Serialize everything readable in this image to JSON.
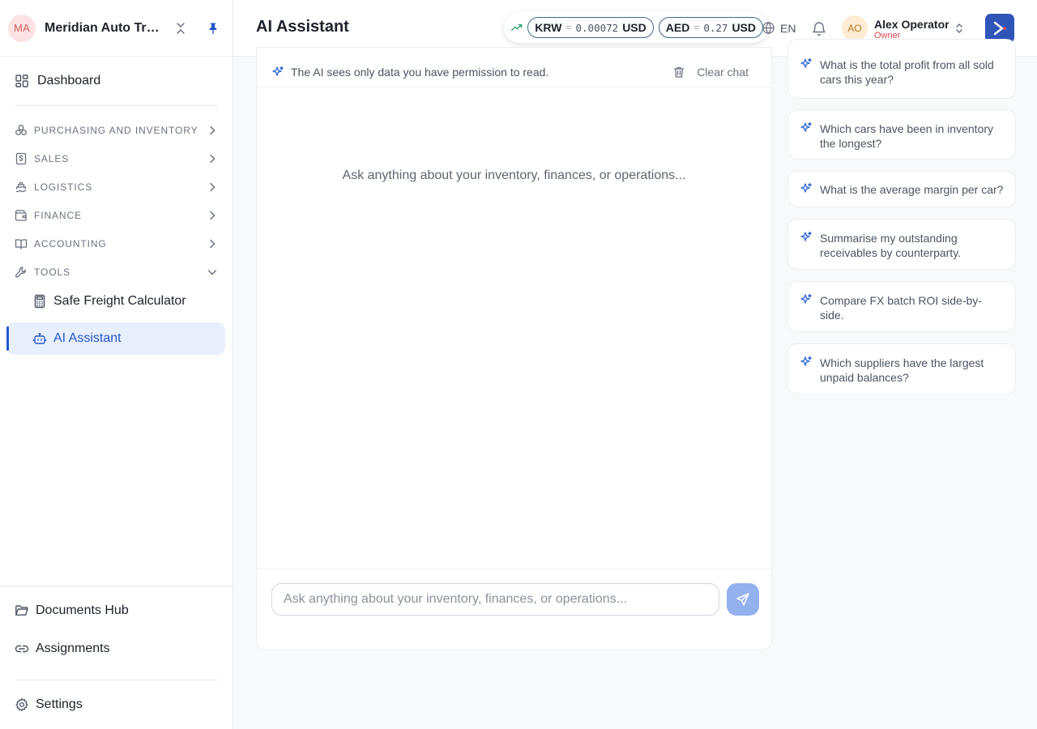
{
  "org": {
    "initials": "MA",
    "name": "Meridian Auto Trading"
  },
  "sidebar": {
    "dashboard": "Dashboard",
    "sections": [
      {
        "label": "PURCHASING AND INVENTORY",
        "icon": "cube-cluster-icon",
        "expanded": false
      },
      {
        "label": "SALES",
        "icon": "dollar-receipt-icon",
        "expanded": false
      },
      {
        "label": "LOGISTICS",
        "icon": "ship-icon",
        "expanded": false
      },
      {
        "label": "FINANCE",
        "icon": "wallet-icon",
        "expanded": false
      },
      {
        "label": "ACCOUNTING",
        "icon": "book-open-icon",
        "expanded": false
      },
      {
        "label": "TOOLS",
        "icon": "wrench-icon",
        "expanded": true
      }
    ],
    "tools_items": [
      {
        "label": "Safe Freight Calculator",
        "icon": "calculator-icon",
        "active": false
      },
      {
        "label": "AI Assistant",
        "icon": "bot-icon",
        "active": true
      }
    ],
    "bottom": {
      "documents": "Documents Hub",
      "assignments": "Assignments",
      "settings": "Settings"
    }
  },
  "header": {
    "title": "AI Assistant",
    "fx": [
      {
        "currency": "KRW",
        "eq": "=",
        "rate": "0.00072",
        "base": "USD"
      },
      {
        "currency": "AED",
        "eq": "=",
        "rate": "0.27",
        "base": "USD"
      }
    ],
    "language": "EN",
    "user": {
      "initials": "AO",
      "name": "Alex Operator",
      "role": "Owner"
    }
  },
  "chat": {
    "notice": "The AI sees only data you have permission to read.",
    "clear_label": "Clear chat",
    "empty_message": "Ask anything about your inventory, finances, or operations...",
    "input_placeholder": "Ask anything about your inventory, finances, or operations...",
    "input_value": ""
  },
  "suggestions": [
    "What is the total profit from all sold cars this year?",
    "Which cars have been in inventory the longest?",
    "What is the average margin per car?",
    "Summarise my outstanding receivables by counterparty.",
    "Compare FX batch ROI side-by-side.",
    "Which suppliers have the largest unpaid balances?"
  ],
  "colors": {
    "accent": "#2456c9",
    "sparkle": "#2b63d9",
    "owner_role": "#e0464a",
    "send_disabled": "#93b0ef"
  }
}
